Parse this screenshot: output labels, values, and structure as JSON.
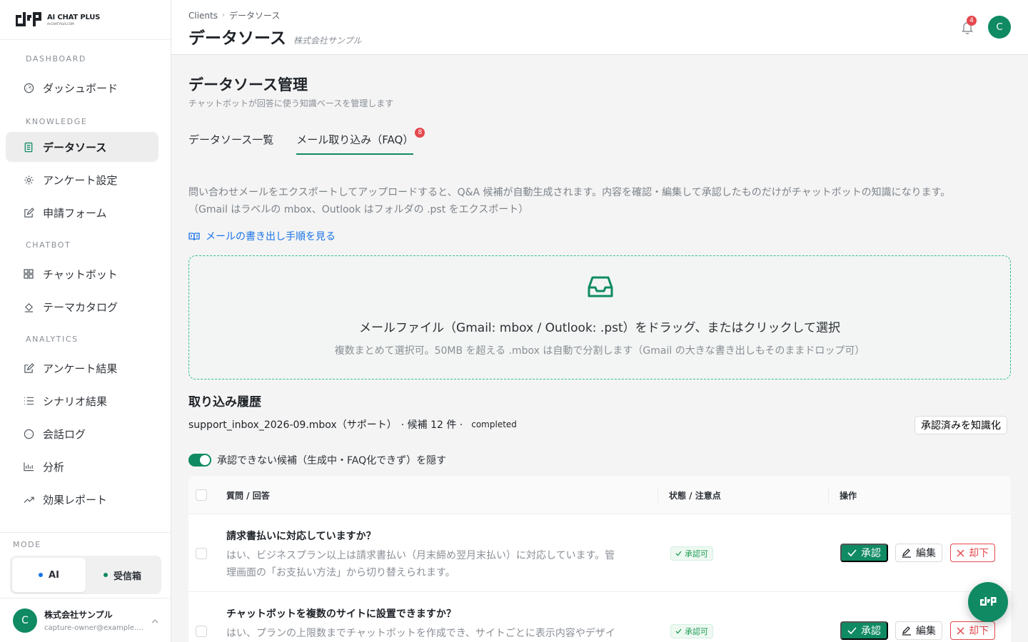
{
  "brand": {
    "name": "AI CHAT PLUS",
    "domain": "AI-CHAT-PLUS.COM"
  },
  "sidebar": {
    "sections": [
      {
        "label": "DASHBOARD"
      },
      {
        "label": "KNOWLEDGE"
      },
      {
        "label": "CHATBOT"
      },
      {
        "label": "ANALYTICS"
      }
    ],
    "items": [
      {
        "label": "ダッシュボード"
      },
      {
        "label": "データソース"
      },
      {
        "label": "アンケート設定"
      },
      {
        "label": "申請フォーム"
      },
      {
        "label": "チャットボット"
      },
      {
        "label": "テーマカタログ"
      },
      {
        "label": "アンケート結果"
      },
      {
        "label": "シナリオ結果"
      },
      {
        "label": "会話ログ"
      },
      {
        "label": "分析"
      },
      {
        "label": "効果レポート"
      }
    ],
    "mode": {
      "label": "MODE",
      "options": [
        "AI",
        "受信箱"
      ],
      "selected": "AI"
    },
    "account": {
      "initial": "C",
      "name": "株式会社サンプル",
      "email": "capture-owner@example.com"
    }
  },
  "header": {
    "breadcrumb": [
      "Clients",
      "データソース"
    ],
    "title": "データソース",
    "subtitle": "株式会社サンプル",
    "notifications": "4",
    "avatar": "C"
  },
  "main": {
    "title": "データソース管理",
    "description": "チャットボットが回答に使う知識ベースを管理します",
    "tabs": [
      {
        "label": "データソース一覧"
      },
      {
        "label": "メール取り込み（FAQ）",
        "badge": "8"
      }
    ],
    "intro_line1": "問い合わせメールをエクスポートしてアップロードすると、Q&A 候補が自動生成されます。内容を確認・編集して承認したものだけがチャットボットの知識になります。",
    "intro_line2": "（Gmail はラベルの mbox、Outlook はフォルダの .pst をエクスポート）",
    "guide_link": "メールの書き出し手順を見る",
    "dropzone": {
      "title": "メールファイル（Gmail: mbox / Outlook: .pst）をドラッグ、またはクリックして選択",
      "subtitle": "複数まとめて選択可。50MB を超える .mbox は自動で分割します（Gmail の大きな書き出しもそのままドロップ可）"
    },
    "history": {
      "title": "取り込み履歴",
      "file": "support_inbox_2026-09.mbox（サポート）",
      "candidates": "· 候補 12 件 ·",
      "status": "completed",
      "approve_all": "承認済みを知識化"
    },
    "hide_toggle": {
      "label": "承認できない候補（生成中・FAQ化できず）を隠す",
      "on": true
    },
    "table": {
      "headers": [
        "質問 / 回答",
        "状態 / 注意点",
        "操作"
      ],
      "rows": [
        {
          "question": "請求書払いに対応していますか？",
          "answer_line1": "はい、ビジネスプラン以上は請求書払い（月末締め翌月末払い）に対応しています。管",
          "answer_line2": "理画面の「お支払い方法」から切り替えられます。",
          "status": "承認可",
          "approve": "承認",
          "edit": "編集",
          "reject": "却下"
        },
        {
          "question": "チャットボットを複数のサイトに設置できますか？",
          "answer_line1": "はい、プランの上限数までチャットボットを作成でき、サイトごとに表示内容やデザイ",
          "answer_line2": "",
          "status": "承認可",
          "approve": "承認",
          "edit": "編集",
          "reject": "却下"
        }
      ]
    }
  },
  "colors": {
    "accent": "#0f8a63",
    "danger": "#e5484d",
    "link": "#1a73e8",
    "ai_dot": "#1a73e8",
    "inbox_dot": "#0f8a63"
  }
}
